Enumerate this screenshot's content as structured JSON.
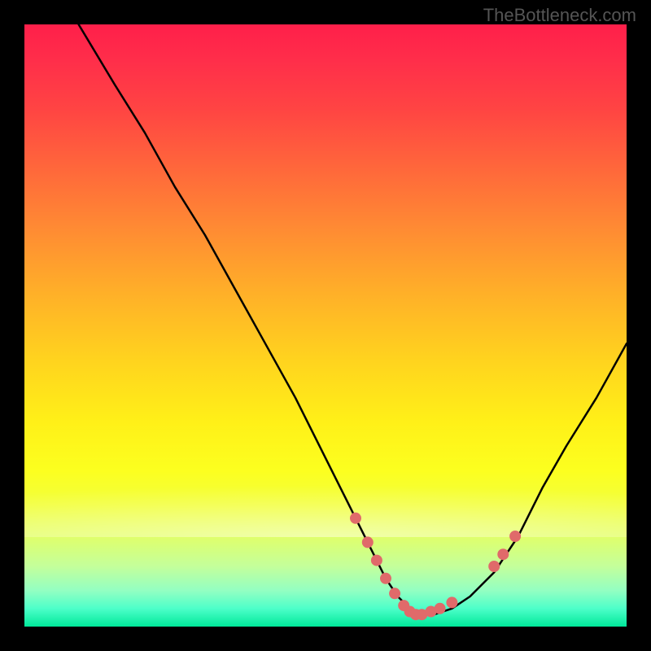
{
  "watermark": "TheBottleneck.com",
  "chart_data": {
    "type": "line",
    "title": "",
    "xlabel": "",
    "ylabel": "",
    "xlim": [
      0,
      100
    ],
    "ylim": [
      0,
      100
    ],
    "grid": false,
    "legend": false,
    "background_gradient": {
      "top": "#ff1f4a",
      "mid": "#fff018",
      "bottom": "#00e89a"
    },
    "curve": {
      "name": "bottleneck-curve",
      "x": [
        9,
        15,
        20,
        25,
        30,
        35,
        40,
        45,
        50,
        53,
        56,
        58,
        60,
        62,
        64,
        66,
        68,
        71,
        74,
        78,
        82,
        86,
        90,
        95,
        100
      ],
      "y": [
        100,
        90,
        82,
        73,
        65,
        56,
        47,
        38,
        28,
        22,
        16,
        12,
        8,
        5,
        3,
        2,
        2,
        3,
        5,
        9,
        15,
        23,
        30,
        38,
        47
      ]
    },
    "marker_points": {
      "name": "bottleneck-markers",
      "color": "#e06a6a",
      "radius": 7,
      "x": [
        55,
        57,
        58.5,
        60,
        61.5,
        63,
        64,
        65,
        66,
        67.5,
        69,
        71,
        78,
        79.5,
        81.5
      ],
      "y": [
        18,
        14,
        11,
        8,
        5.5,
        3.5,
        2.5,
        2,
        2,
        2.5,
        3,
        4,
        10,
        12,
        15
      ]
    }
  }
}
